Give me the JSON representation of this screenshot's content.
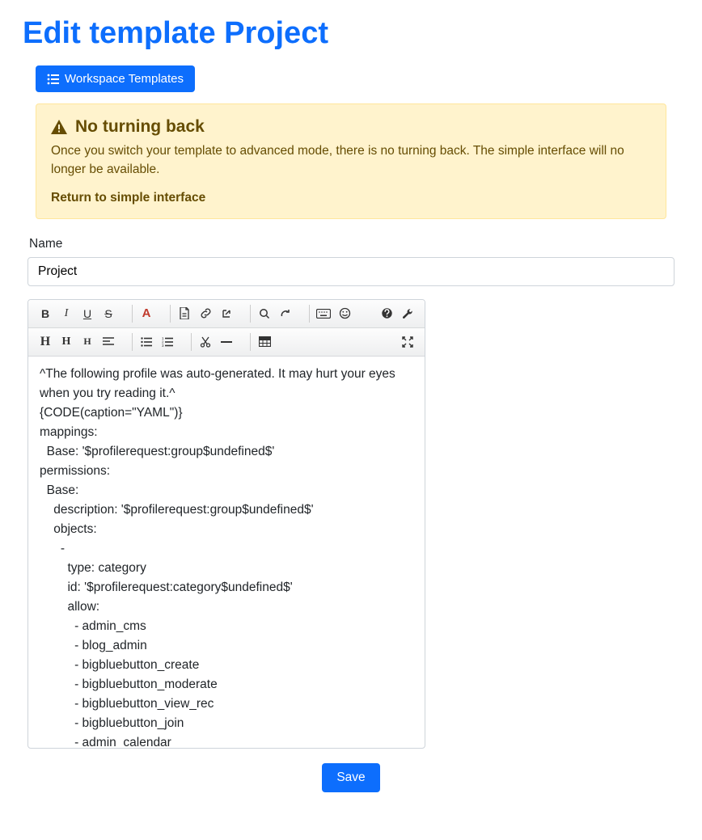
{
  "page": {
    "title": "Edit template Project"
  },
  "buttons": {
    "workspace_templates": "Workspace Templates",
    "save": "Save"
  },
  "alert": {
    "title": "No turning back",
    "body": "Once you switch your template to advanced mode, there is no turning back. The simple interface will no longer be available.",
    "link": "Return to simple interface"
  },
  "form": {
    "name_label": "Name",
    "name_value": "Project"
  },
  "toolbar": {
    "row1": {
      "bold": "B",
      "italic": "I",
      "underline": "U",
      "strike": "S",
      "color": "A"
    },
    "row2": {
      "h1": "H",
      "h2": "H",
      "h3": "H"
    }
  },
  "editor": {
    "content": "^The following profile was auto-generated. It may hurt your eyes when you try reading it.^\n{CODE(caption=\"YAML\")}\nmappings:\n  Base: '$profilerequest:group$undefined$'\npermissions:\n  Base:\n    description: '$profilerequest:group$undefined$'\n    objects:\n      -\n        type: category\n        id: '$profilerequest:category$undefined$'\n        allow:\n          - admin_cms\n          - blog_admin\n          - bigbluebutton_create\n          - bigbluebutton_moderate\n          - bigbluebutton_view_rec\n          - bigbluebutton_join\n          - admin_calendar"
  }
}
